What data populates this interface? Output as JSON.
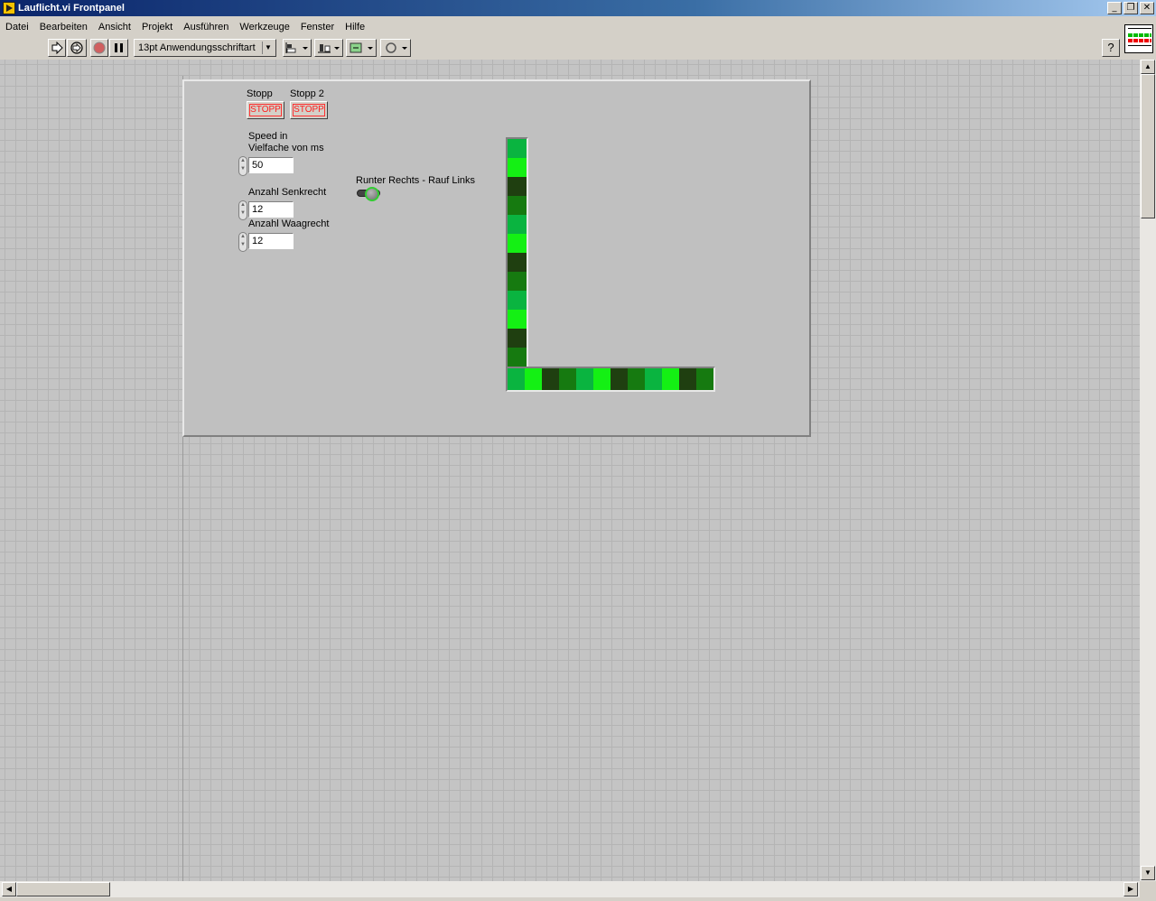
{
  "window": {
    "title": "Lauflicht.vi Frontpanel"
  },
  "menu": [
    "Datei",
    "Bearbeiten",
    "Ansicht",
    "Projekt",
    "Ausführen",
    "Werkzeuge",
    "Fenster",
    "Hilfe"
  ],
  "toolbar": {
    "font": "13pt Anwendungsschriftart",
    "help": "?"
  },
  "controls": {
    "stop1": {
      "label": "Stopp",
      "button": "STOPP"
    },
    "stop2": {
      "label": "Stopp 2",
      "button": "STOPP"
    },
    "speed": {
      "label_line1": "Speed in",
      "label_line2": "Vielfache von ms",
      "value": "50"
    },
    "senkrecht": {
      "label": "Anzahl Senkrecht",
      "value": "12"
    },
    "waagrecht": {
      "label": "Anzahl Waagrecht",
      "value": "12"
    },
    "direction": {
      "label": "Runter Rechts - Rauf Links"
    }
  },
  "led_colors": {
    "dark": "#1f3f10",
    "mid": "#167a10",
    "teal": "#0ab440",
    "bright": "#14f014"
  },
  "led_arrays": {
    "vertical": [
      "teal",
      "bright",
      "dark",
      "mid",
      "teal",
      "bright",
      "dark",
      "mid",
      "teal",
      "bright",
      "dark",
      "mid"
    ],
    "horizontal": [
      "teal",
      "bright",
      "dark",
      "mid",
      "teal",
      "bright",
      "dark",
      "mid",
      "teal",
      "bright",
      "dark",
      "mid"
    ]
  }
}
